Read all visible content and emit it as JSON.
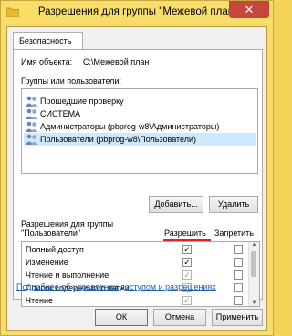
{
  "window": {
    "title": "Разрешения для группы \"Межевой план\"",
    "close_glyph": "✕"
  },
  "tabs": [
    {
      "label": "Безопасность"
    }
  ],
  "object": {
    "label": "Имя объекта:",
    "value": "C:\\Межевой план"
  },
  "groups": {
    "label": "Группы или пользователи:",
    "items": [
      {
        "label": "Прошедшие проверку",
        "selected": false
      },
      {
        "label": "СИСТЕМА",
        "selected": false
      },
      {
        "label": "Администраторы (pbprog-w8\\Администраторы)",
        "selected": false
      },
      {
        "label": "Пользователи (pbprog-w8\\Пользователи)",
        "selected": true
      }
    ]
  },
  "buttons": {
    "add": "Добавить...",
    "remove": "Удалить",
    "ok": "ОК",
    "cancel": "Отмена",
    "apply": "Применить"
  },
  "permissions": {
    "label_line1": "Разрешения для группы",
    "label_line2": "\"Пользователи\"",
    "allow_header": "Разрешить",
    "deny_header": "Запретить",
    "rows": [
      {
        "label": "Полный доступ",
        "allow": true,
        "allow_grey": false,
        "deny": false
      },
      {
        "label": "Изменение",
        "allow": true,
        "allow_grey": false,
        "deny": false
      },
      {
        "label": "Чтение и выполнение",
        "allow": true,
        "allow_grey": true,
        "deny": false
      },
      {
        "label": "Список содержимого папки",
        "allow": true,
        "allow_grey": true,
        "deny": false
      },
      {
        "label": "Чтение",
        "allow": true,
        "allow_grey": true,
        "deny": false
      }
    ],
    "check_glyph": "✓"
  },
  "link": {
    "label": "Подробнее об управлении доступом и разрешениях"
  },
  "colors": {
    "title_bg": "#f9dd6b",
    "close_bg": "#c7463a",
    "highlight": "#e02020",
    "selection": "#cde8ff"
  }
}
